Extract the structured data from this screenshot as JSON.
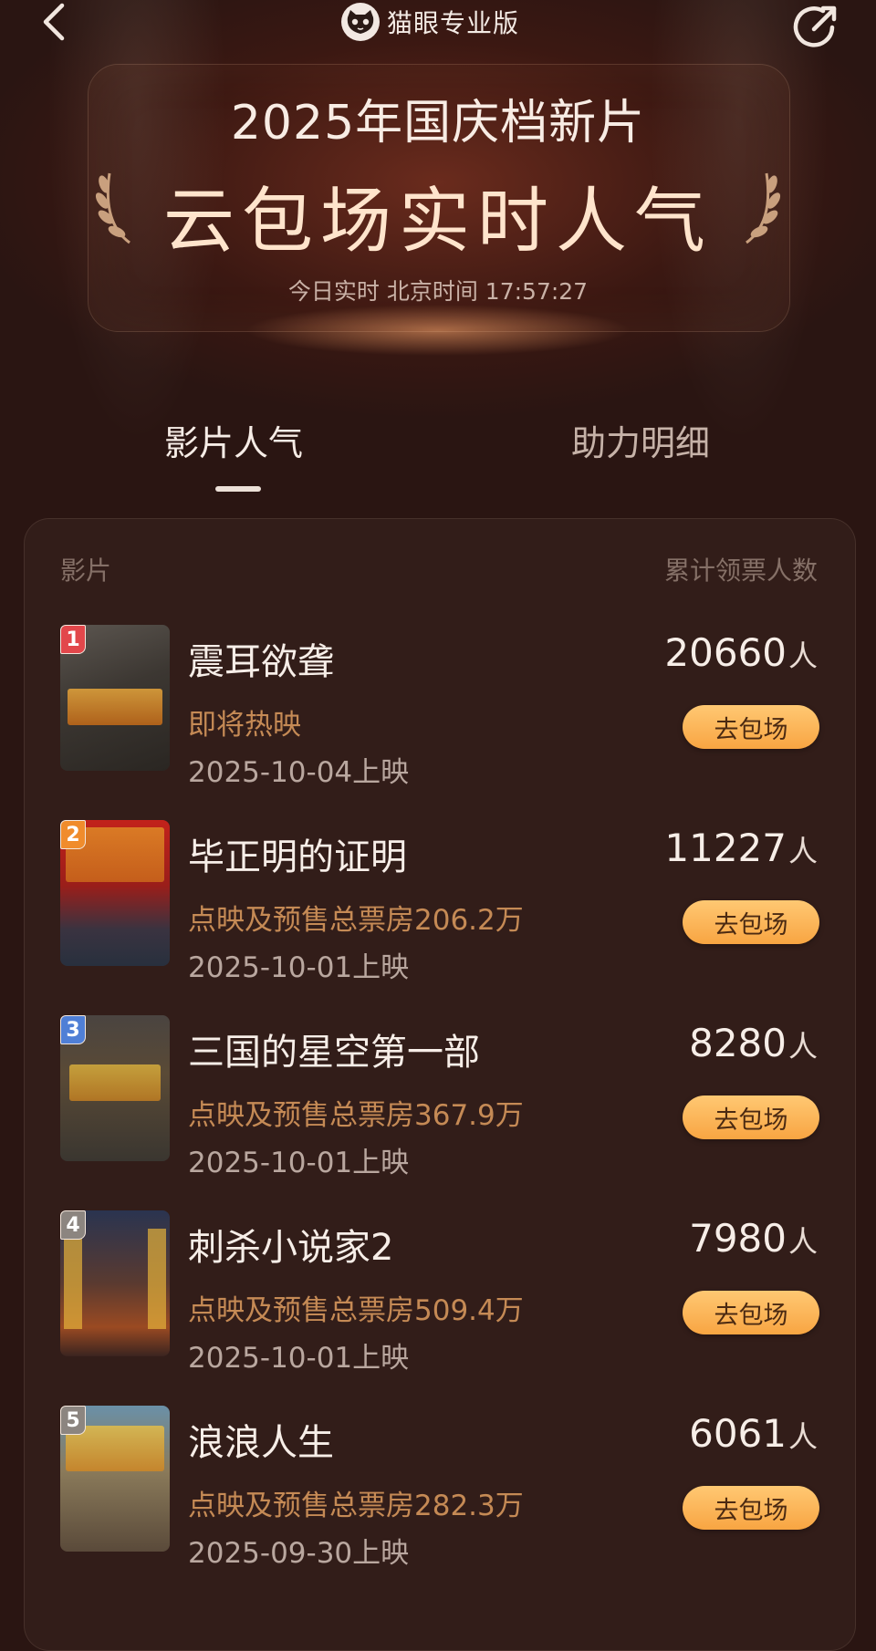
{
  "brand": {
    "name": "猫眼专业版"
  },
  "banner": {
    "title_line1": "2025年国庆档新片",
    "title_line2": "云包场实时人气",
    "realtime_label": "今日实时 北京时间 17:57:27"
  },
  "tabs": [
    {
      "label": "影片人气",
      "active": true
    },
    {
      "label": "助力明细",
      "active": false
    }
  ],
  "list_header": {
    "film": "影片",
    "count": "累计领票人数"
  },
  "movies": [
    {
      "rank": "1",
      "title": "震耳欲聋",
      "status": "即将热映",
      "release": "2025-10-04上映",
      "count": "20660",
      "unit": "人",
      "button": "去包场",
      "rank_color": "#e2474b"
    },
    {
      "rank": "2",
      "title": "毕正明的证明",
      "status": "点映及预售总票房206.2万",
      "release": "2025-10-01上映",
      "count": "11227",
      "unit": "人",
      "button": "去包场",
      "rank_color": "#f08c2c"
    },
    {
      "rank": "3",
      "title": "三国的星空第一部",
      "status": "点映及预售总票房367.9万",
      "release": "2025-10-01上映",
      "count": "8280",
      "unit": "人",
      "button": "去包场",
      "rank_color": "#4f7fd6"
    },
    {
      "rank": "4",
      "title": "刺杀小说家2",
      "status": "点映及预售总票房509.4万",
      "release": "2025-10-01上映",
      "count": "7980",
      "unit": "人",
      "button": "去包场",
      "rank_color": "#8c8580"
    },
    {
      "rank": "5",
      "title": "浪浪人生",
      "status": "点映及预售总票房282.3万",
      "release": "2025-09-30上映",
      "count": "6061",
      "unit": "人",
      "button": "去包场",
      "rank_color": "#8c8580"
    }
  ],
  "colors": {
    "background": "#2a1512",
    "card": "#321d19",
    "accent_button": "#f8a542",
    "status_text": "#c58a55"
  }
}
